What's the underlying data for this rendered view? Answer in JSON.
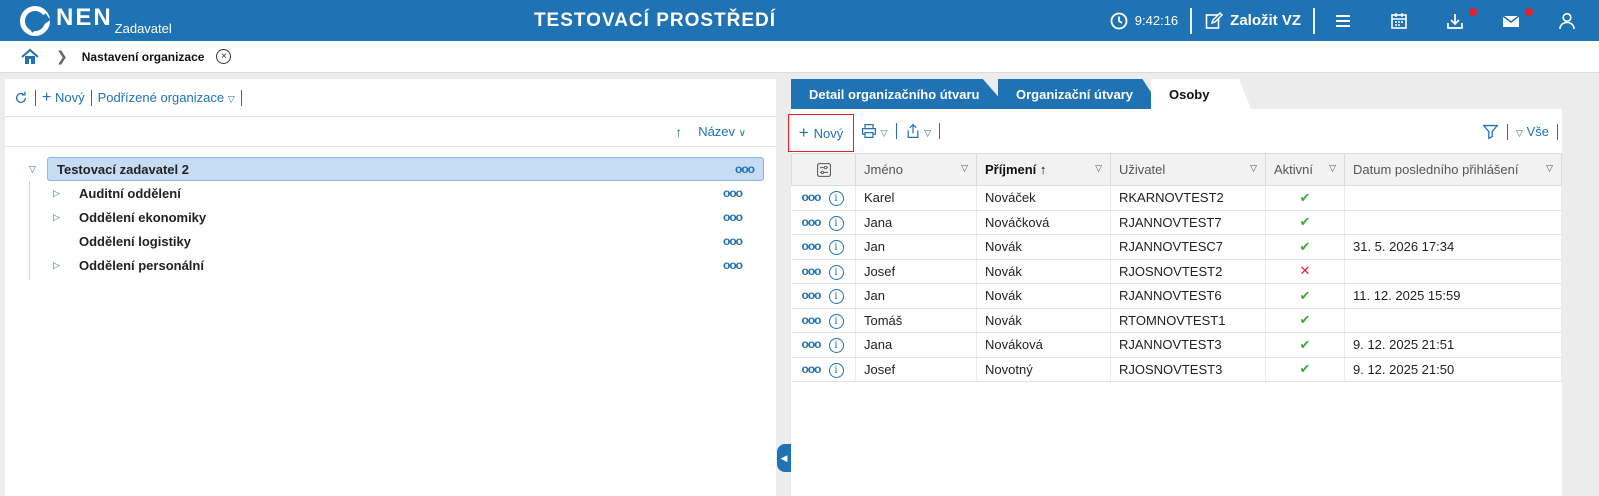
{
  "header": {
    "logo_text": "NEN",
    "logo_sub": "Zadavatel",
    "env_title": "TESTOVACÍ PROSTŘEDÍ",
    "time": "9:42:16",
    "create_label": "Založit VZ",
    "icons": [
      "clock-icon",
      "edit-icon",
      "menu-icon",
      "calendar-icon",
      "download-icon",
      "mail-icon",
      "user-icon"
    ],
    "badge_color": "#e3202b",
    "brand_color": "#1f72b3"
  },
  "breadcrumb": {
    "label": "Nastavení organizace",
    "close_glyph": "×"
  },
  "left": {
    "toolbar": {
      "new_label": "Nový",
      "sub_orgs_label": "Podřízené organizace"
    },
    "sort_label": "Název",
    "tree": {
      "root": "Testovací zadavatel 2",
      "children": [
        {
          "label": "Auditní oddělení",
          "expandable": true
        },
        {
          "label": "Oddělení ekonomiky",
          "expandable": true
        },
        {
          "label": "Oddělení logistiky",
          "expandable": false
        },
        {
          "label": "Oddělení personální",
          "expandable": true
        }
      ]
    }
  },
  "tabs": [
    {
      "label": "Detail organizačního útvaru",
      "active": false
    },
    {
      "label": "Organizační útvary",
      "active": false
    },
    {
      "label": "Osoby",
      "active": true
    }
  ],
  "right": {
    "toolbar": {
      "new_label": "Nový",
      "all_label": "Vše"
    },
    "columns": [
      "Jméno",
      "Příjmení",
      "Uživatel",
      "Aktivní",
      "Datum posledního přihlášení"
    ],
    "rows": [
      {
        "jmeno": "Karel",
        "prijmeni": "Nováček",
        "uzivatel": "RKARNOVTEST2",
        "aktivni": "✔",
        "datum": ""
      },
      {
        "jmeno": "Jana",
        "prijmeni": "Nováčková",
        "uzivatel": "RJANNOVTEST7",
        "aktivni": "✔",
        "datum": ""
      },
      {
        "jmeno": "Jan",
        "prijmeni": "Novák",
        "uzivatel": "RJANNOVTESC7",
        "aktivni": "✔",
        "datum": "31. 5. 2026 17:34"
      },
      {
        "jmeno": "Josef",
        "prijmeni": "Novák",
        "uzivatel": "RJOSNOVTEST2",
        "aktivni": "✕",
        "datum": ""
      },
      {
        "jmeno": "Jan",
        "prijmeni": "Novák",
        "uzivatel": "RJANNOVTEST6",
        "aktivni": "✔",
        "datum": "11. 12. 2025 15:59"
      },
      {
        "jmeno": "Tomáš",
        "prijmeni": "Novák",
        "uzivatel": "RTOMNOVTEST1",
        "aktivni": "✔",
        "datum": ""
      },
      {
        "jmeno": "Jana",
        "prijmeni": "Nováková",
        "uzivatel": "RJANNOVTEST3",
        "aktivni": "✔",
        "datum": "9. 12. 2025 21:51"
      },
      {
        "jmeno": "Josef",
        "prijmeni": "Novotný",
        "uzivatel": "RJOSNOVTEST3",
        "aktivni": "✔",
        "datum": "9. 12. 2025 21:50"
      }
    ]
  }
}
